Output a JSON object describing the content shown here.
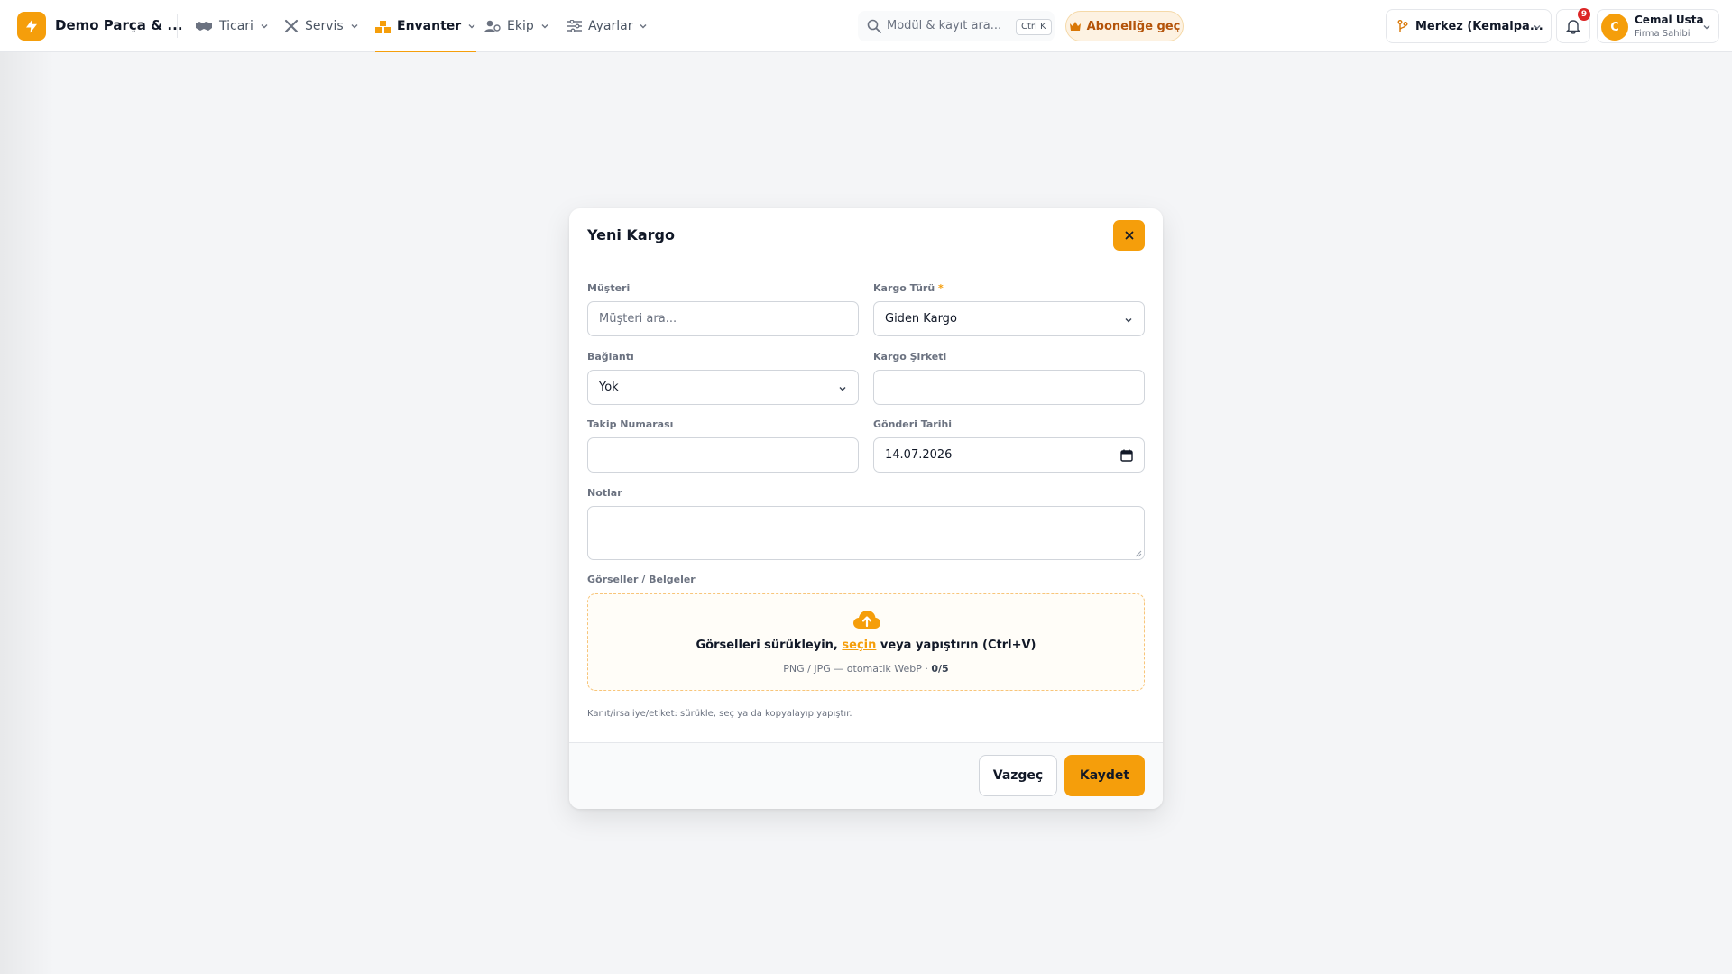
{
  "app": {
    "brand": "Demo Parça & ...",
    "logo_icon": "lightning-icon",
    "accent_color": "#f59e0b"
  },
  "nav": {
    "items": [
      {
        "label": "Ticari",
        "icon": "handshake-icon"
      },
      {
        "label": "Servis",
        "icon": "tools-icon"
      },
      {
        "label": "Envanter",
        "icon": "boxes-icon",
        "active": true
      },
      {
        "label": "Ekip",
        "icon": "users-icon"
      },
      {
        "label": "Ayarlar",
        "icon": "sliders-icon"
      }
    ]
  },
  "search": {
    "placeholder": "Modül & kayıt ara...",
    "shortcut": "Ctrl K"
  },
  "upgrade": {
    "label": "Aboneliğe geç",
    "icon": "crown-icon"
  },
  "branch": {
    "label": "Merkez (Kemalpa...",
    "icon": "branch-icon"
  },
  "notifications": {
    "count": "9",
    "icon": "bell-icon"
  },
  "user": {
    "initial": "C",
    "name": "Cemal Usta",
    "role": "Firma Sahibi"
  },
  "modal": {
    "title": "Yeni Kargo",
    "fields": {
      "customer": {
        "label": "Müşteri",
        "placeholder": "Müşteri ara..."
      },
      "cargo_type": {
        "label": "Kargo Türü",
        "required": "*",
        "value": "Giden Kargo"
      },
      "link": {
        "label": "Bağlantı",
        "value": "Yok"
      },
      "company": {
        "label": "Kargo Şirketi",
        "value": ""
      },
      "tracking": {
        "label": "Takip Numarası",
        "value": ""
      },
      "date": {
        "label": "Gönderi Tarihi",
        "value": "14.07.2026"
      },
      "notes": {
        "label": "Notlar",
        "value": ""
      }
    },
    "attachments": {
      "label": "Görseller / Belgeler",
      "drop_text_before": "Görselleri sürükleyin, ",
      "drop_link": "seçin",
      "drop_text_after": " veya yapıştırın (Ctrl+V)",
      "formats": "PNG / JPG — otomatik WebP · ",
      "count": "0/5"
    },
    "hint": "Kanıt/irsaliye/etiket: sürükle, seç ya da kopyalayıp yapıştır.",
    "cancel_label": "Vazgeç",
    "save_label": "Kaydet"
  }
}
